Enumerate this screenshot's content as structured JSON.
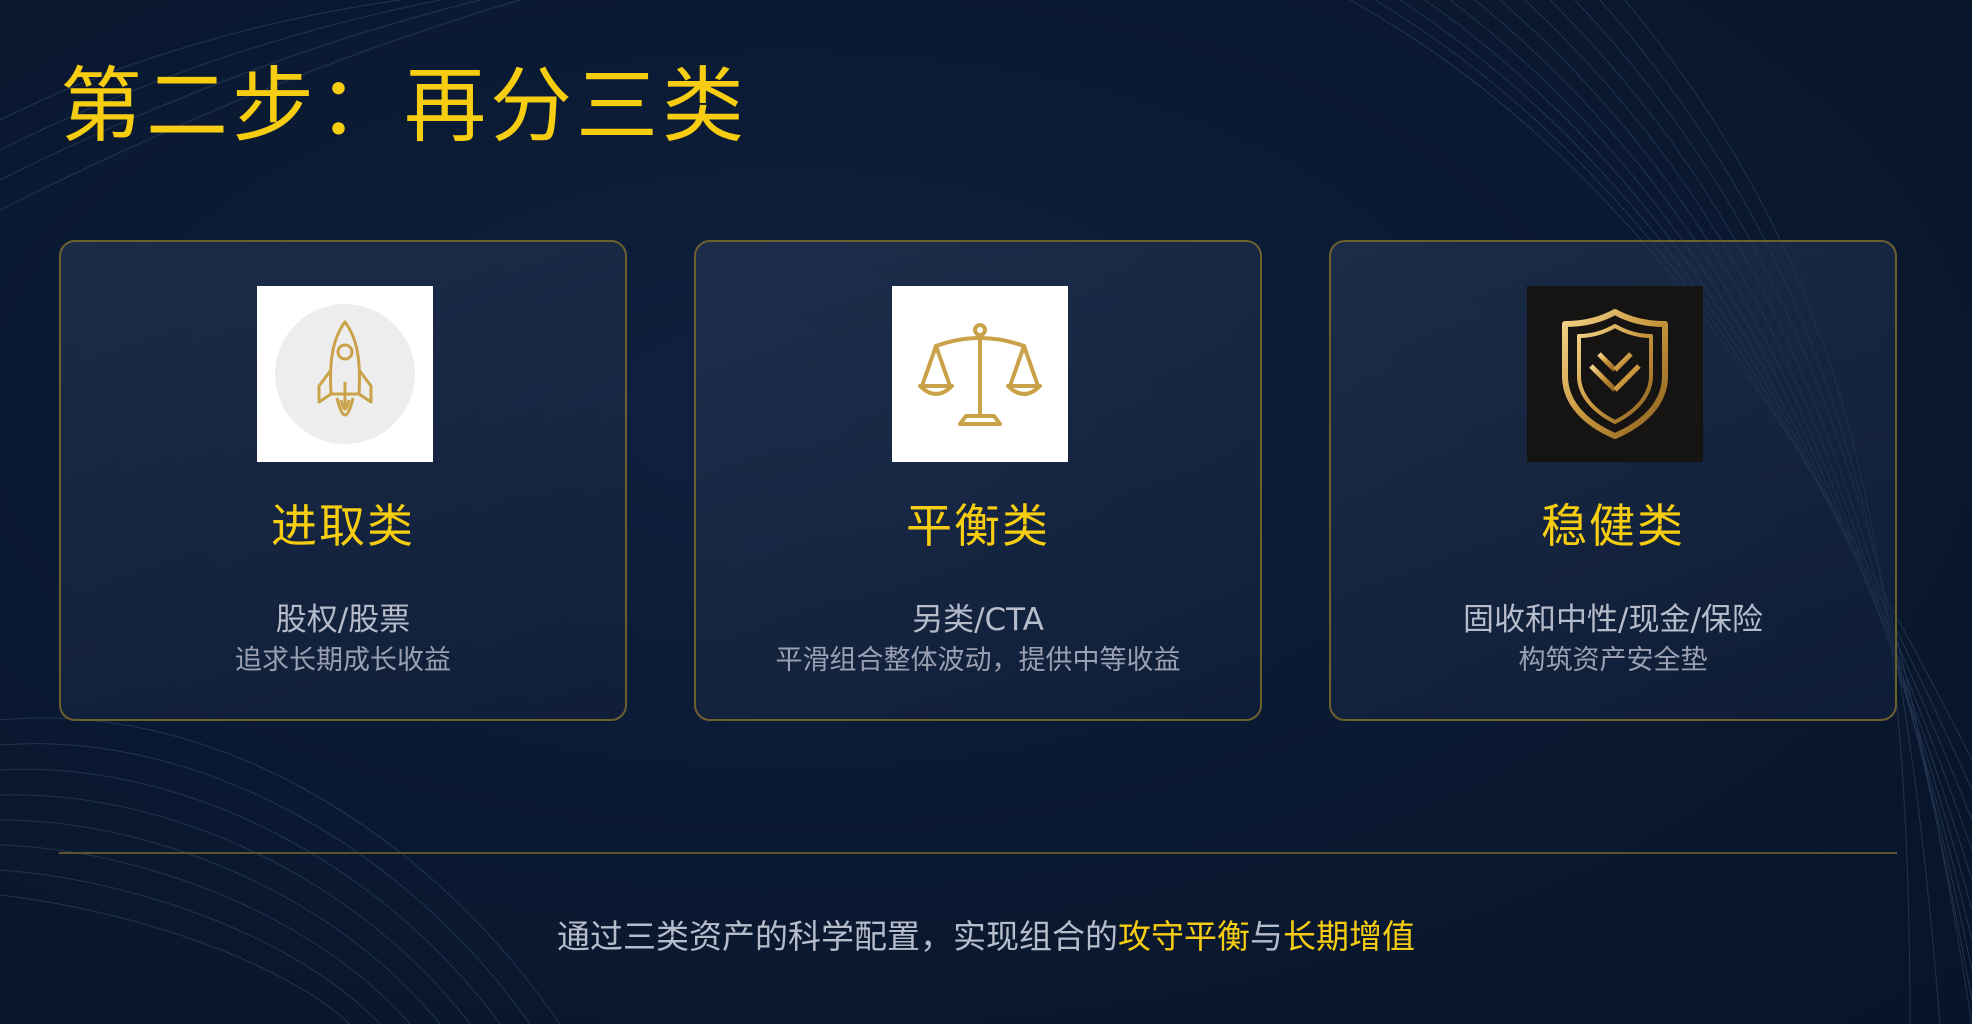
{
  "title": "第二步：再分三类",
  "cards": [
    {
      "icon": "rocket-icon",
      "title": "进取类",
      "subtitle": "股权/股票",
      "description": "追求长期成长收益"
    },
    {
      "icon": "balance-scale-icon",
      "title": "平衡类",
      "subtitle": "另类/CTA",
      "description": "平滑组合整体波动，提供中等收益"
    },
    {
      "icon": "shield-icon",
      "title": "稳健类",
      "subtitle": "固收和中性/现金/保险",
      "description": "构筑资产安全垫"
    }
  ],
  "footer": {
    "text1": "通过三类资产的科学配置，实现组合的",
    "highlight1": "攻守平衡",
    "text2": "与",
    "highlight2": "长期增值"
  },
  "colors": {
    "accent": "#f6cd10",
    "background": "#0b1a33",
    "border": "#6e5f2f",
    "text": "#b7bccb"
  }
}
